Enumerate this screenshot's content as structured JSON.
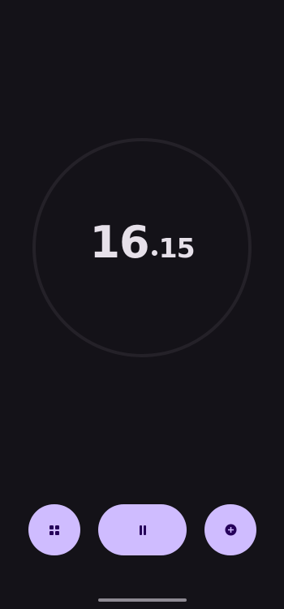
{
  "stopwatch": {
    "seconds": "16",
    "hundredths": "15"
  },
  "controls": {
    "left_icon": "grid-icon",
    "center_icon": "pause-icon",
    "right_icon": "add-circle-icon"
  },
  "colors": {
    "background": "#141218",
    "ring": "#242128",
    "text": "#E6E0E9",
    "button": "#CFBCFF",
    "button_icon": "#25005A"
  }
}
